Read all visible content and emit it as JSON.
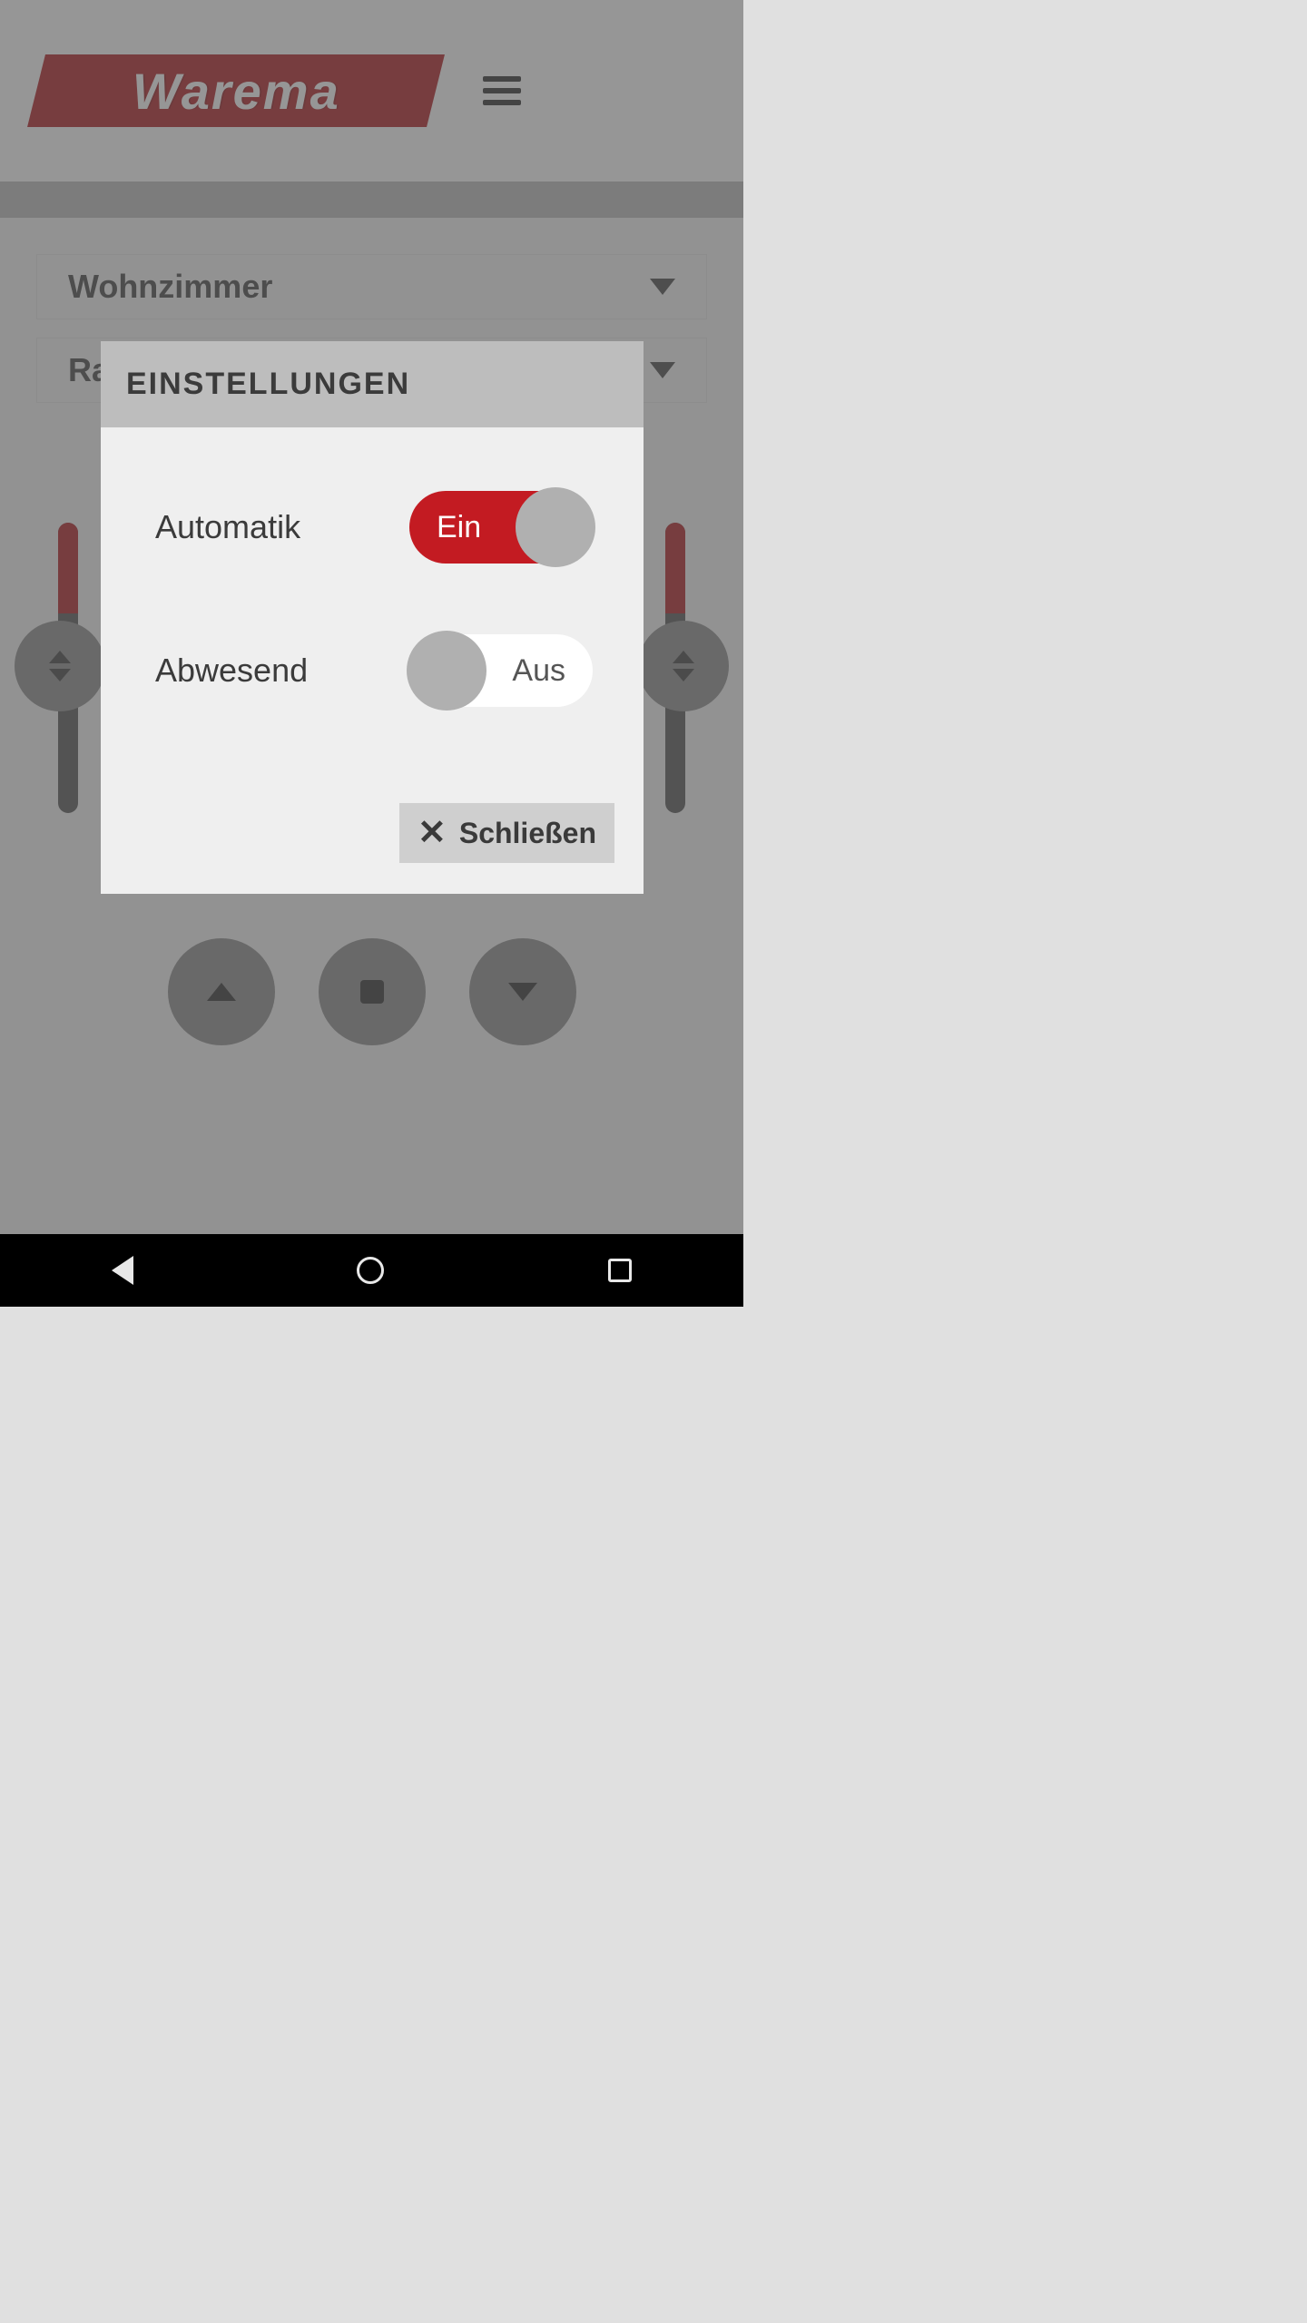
{
  "brand": "Warema",
  "dropdowns": {
    "room": "Wohnzimmer",
    "second_prefix": "Ra"
  },
  "modal": {
    "title": "EINSTELLUNGEN",
    "automatik": {
      "label": "Automatik",
      "state_text": "Ein",
      "on": true
    },
    "abwesend": {
      "label": "Abwesend",
      "state_text": "Aus",
      "on": false
    },
    "close_label": "Schließen"
  }
}
